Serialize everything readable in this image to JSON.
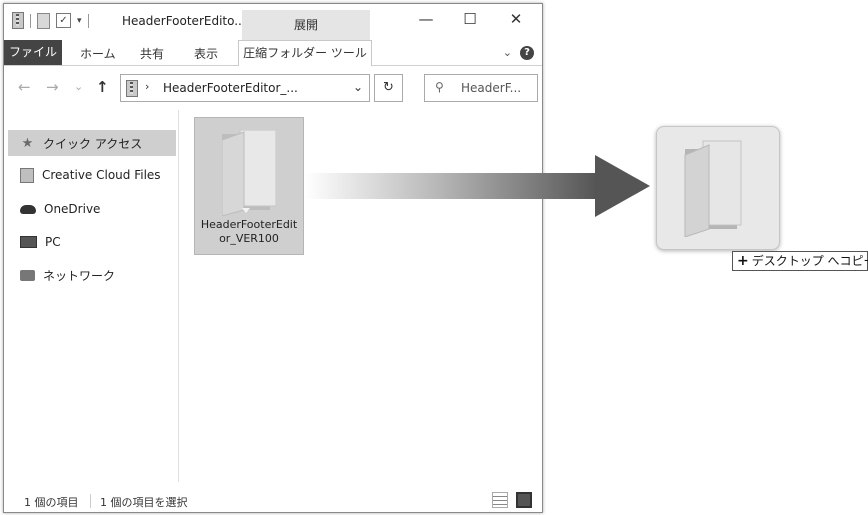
{
  "window": {
    "title": "HeaderFooterEdito...",
    "context_tab": "展開",
    "controls": {
      "minimize": "—",
      "maximize": "☐",
      "close": "✕"
    }
  },
  "ribbon": {
    "file": "ファイル",
    "tabs": [
      "ホーム",
      "共有",
      "表示"
    ],
    "tool_tab": "圧縮フォルダー ツール",
    "expand": "⌄",
    "help": "?"
  },
  "nav": {
    "back": "←",
    "forward": "→",
    "recent": "⌄",
    "up": "↑",
    "address_arrow": "›",
    "address_path": "HeaderFooterEditor_...",
    "address_dropdown": "⌄",
    "refresh": "↻",
    "search_placeholder": "HeaderF..."
  },
  "sidebar": {
    "items": [
      {
        "label": "クイック アクセス",
        "icon": "star-icon"
      },
      {
        "label": "Creative Cloud Files",
        "icon": "creative-cloud-icon"
      },
      {
        "label": "OneDrive",
        "icon": "cloud-icon"
      },
      {
        "label": "PC",
        "icon": "pc-icon"
      },
      {
        "label": "ネットワーク",
        "icon": "network-icon"
      }
    ]
  },
  "content": {
    "folder_name_line1": "HeaderFooterEdit",
    "folder_name_line2": "or_VER100"
  },
  "status": {
    "count": "1 個の項目",
    "selected": "1 個の項目を選択"
  },
  "drag": {
    "tooltip_symbol": "+",
    "tooltip_text": "デスクトップ へコピー"
  },
  "colors": {
    "selection": "#cfcfcf",
    "file_tab": "#444444",
    "context_tab": "#e5e5e5"
  }
}
